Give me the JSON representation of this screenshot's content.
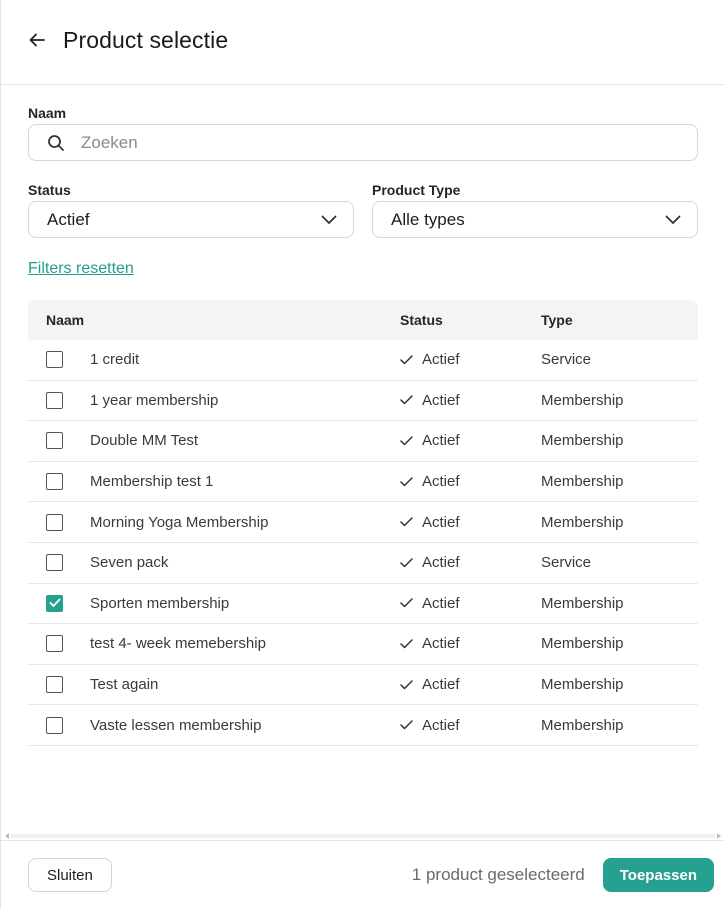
{
  "header": {
    "title": "Product selectie",
    "back_icon": "arrow-left-icon"
  },
  "filters": {
    "name_label": "Naam",
    "search_placeholder": "Zoeken",
    "status_label": "Status",
    "status_value": "Actief",
    "type_label": "Product Type",
    "type_value": "Alle types",
    "reset_label": "Filters resetten"
  },
  "table": {
    "columns": [
      "Naam",
      "Status",
      "Type"
    ],
    "rows": [
      {
        "name": "1 credit",
        "status": "Actief",
        "type": "Service",
        "checked": false
      },
      {
        "name": "1 year membership",
        "status": "Actief",
        "type": "Membership",
        "checked": false
      },
      {
        "name": "Double MM Test",
        "status": "Actief",
        "type": "Membership",
        "checked": false
      },
      {
        "name": "Membership test 1",
        "status": "Actief",
        "type": "Membership",
        "checked": false
      },
      {
        "name": "Morning Yoga Membership",
        "status": "Actief",
        "type": "Membership",
        "checked": false
      },
      {
        "name": "Seven pack",
        "status": "Actief",
        "type": "Service",
        "checked": false
      },
      {
        "name": "Sporten membership",
        "status": "Actief",
        "type": "Membership",
        "checked": true
      },
      {
        "name": "test 4- week memebership",
        "status": "Actief",
        "type": "Membership",
        "checked": false
      },
      {
        "name": "Test again",
        "status": "Actief",
        "type": "Membership",
        "checked": false
      },
      {
        "name": "Vaste lessen membership",
        "status": "Actief",
        "type": "Membership",
        "checked": false
      }
    ]
  },
  "footer": {
    "close_label": "Sluiten",
    "selected_text": "1 product geselecteerd",
    "apply_label": "Toepassen"
  },
  "colors": {
    "accent": "#26a08f",
    "link": "#1f9e8c"
  }
}
